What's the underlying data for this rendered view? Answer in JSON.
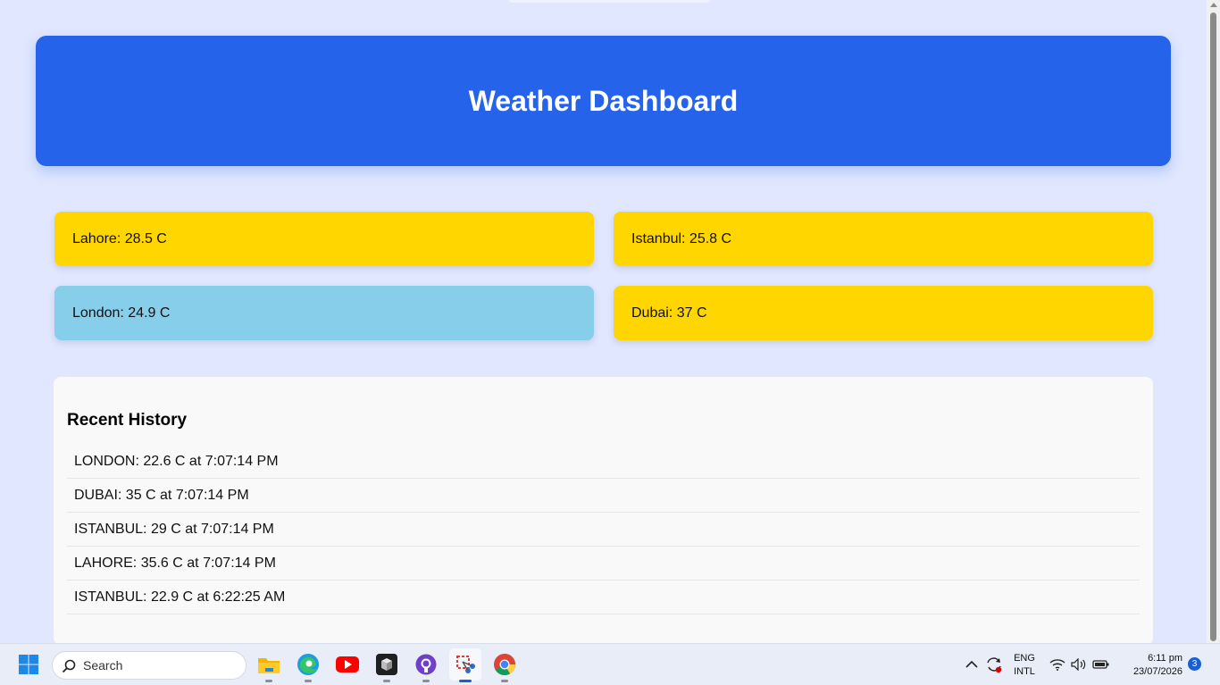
{
  "page": {
    "title": "Weather Dashboard"
  },
  "colors": {
    "background": "#e0e7ff",
    "header": "#2563eb",
    "warm_card": "#ffd600",
    "cool_card": "#87ceeb"
  },
  "cards": [
    {
      "label": "Lahore: 28.5 C",
      "color": "#ffd600"
    },
    {
      "label": "Istanbul: 25.8 C",
      "color": "#ffd600"
    },
    {
      "label": "London: 24.9 C",
      "color": "#87ceeb"
    },
    {
      "label": "Dubai: 37 C",
      "color": "#ffd600"
    }
  ],
  "history": {
    "title": "Recent History",
    "items": [
      "LONDON: 22.6 C at 7:07:14 PM",
      "DUBAI: 35 C at 7:07:14 PM",
      "ISTANBUL: 29 C at 7:07:14 PM",
      "LAHORE: 35.6 C at 7:07:14 PM",
      "ISTANBUL: 22.9 C at 6:22:25 AM"
    ]
  },
  "taskbar": {
    "search_placeholder": "Search",
    "apps": [
      "start-icon",
      "file-explorer-icon",
      "edge-icon",
      "youtube-icon",
      "notes-app-icon",
      "github-icon",
      "snipping-tool-icon",
      "chrome-icon"
    ],
    "lang_top": "ENG",
    "lang_bottom": "INTL",
    "time": "6:11 pm",
    "date": "23/07/2026",
    "notification_count": "3"
  }
}
